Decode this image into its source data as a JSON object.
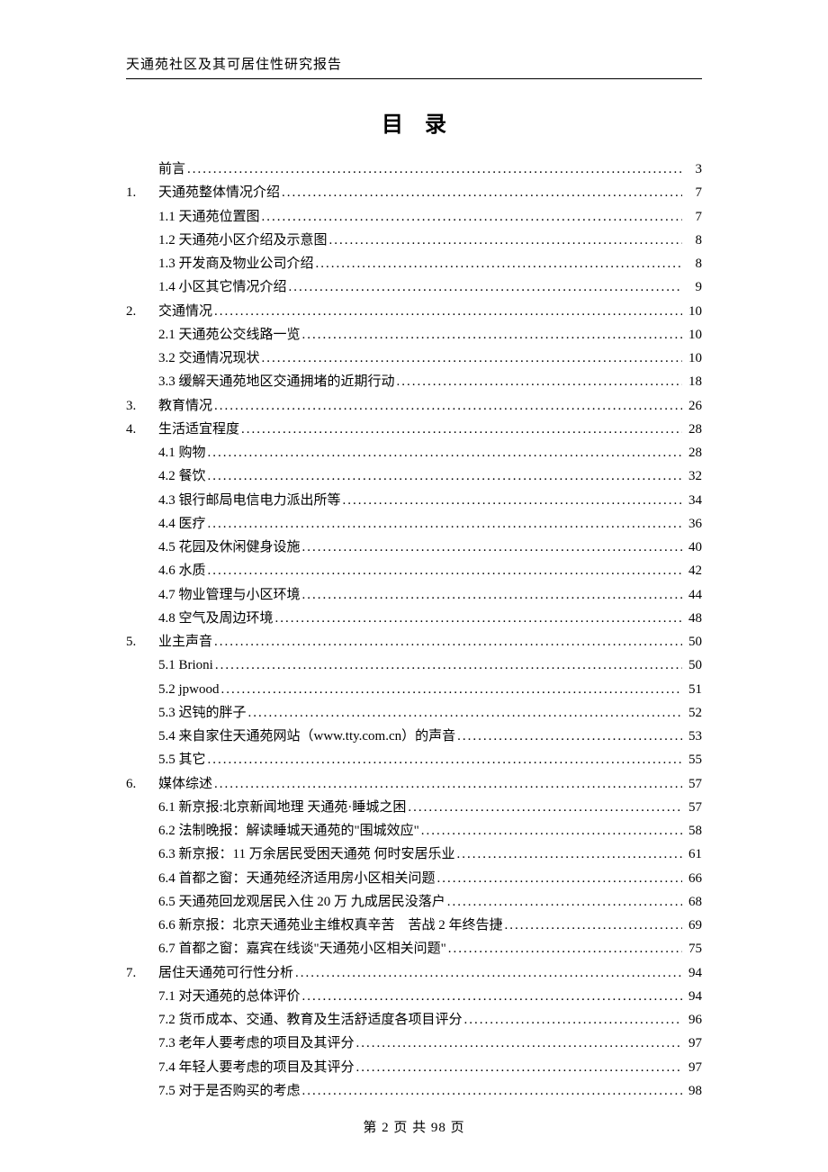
{
  "header_title": "天通苑社区及其可居住性研究报告",
  "toc_heading": "目录",
  "footer": "第 2 页 共 98 页",
  "toc": [
    {
      "level": 0,
      "num": "",
      "label": "前言",
      "page": "3"
    },
    {
      "level": 0,
      "num": "1.",
      "label": "天通苑整体情况介绍",
      "page": "7"
    },
    {
      "level": 1,
      "num": "",
      "label": "1.1 天通苑位置图",
      "page": "7"
    },
    {
      "level": 1,
      "num": "",
      "label": "1.2 天通苑小区介绍及示意图",
      "page": "8"
    },
    {
      "level": 1,
      "num": "",
      "label": "1.3 开发商及物业公司介绍",
      "page": "8"
    },
    {
      "level": 1,
      "num": "",
      "label": "1.4 小区其它情况介绍",
      "page": "9"
    },
    {
      "level": 0,
      "num": "2.",
      "label": "交通情况",
      "page": "10"
    },
    {
      "level": 1,
      "num": "",
      "label": "2.1 天通苑公交线路一览",
      "page": "10"
    },
    {
      "level": 1,
      "num": "",
      "label": "3.2 交通情况现状",
      "page": "10"
    },
    {
      "level": 1,
      "num": "",
      "label": "3.3 缓解天通苑地区交通拥堵的近期行动",
      "page": "18"
    },
    {
      "level": 0,
      "num": "3.",
      "label": "教育情况",
      "page": "26"
    },
    {
      "level": 0,
      "num": "4.",
      "label": "生活适宜程度",
      "page": "28"
    },
    {
      "level": 1,
      "num": "",
      "label": "4.1 购物",
      "page": "28"
    },
    {
      "level": 1,
      "num": "",
      "label": "4.2 餐饮",
      "page": "32"
    },
    {
      "level": 1,
      "num": "",
      "label": "4.3 银行邮局电信电力派出所等",
      "page": "34"
    },
    {
      "level": 1,
      "num": "",
      "label": "4.4 医疗",
      "page": "36"
    },
    {
      "level": 1,
      "num": "",
      "label": "4.5 花园及休闲健身设施",
      "page": "40"
    },
    {
      "level": 1,
      "num": "",
      "label": "4.6 水质",
      "page": "42"
    },
    {
      "level": 1,
      "num": "",
      "label": "4.7 物业管理与小区环境",
      "page": "44"
    },
    {
      "level": 1,
      "num": "",
      "label": "4.8 空气及周边环境",
      "page": "48"
    },
    {
      "level": 0,
      "num": "5.",
      "label": "业主声音",
      "page": "50"
    },
    {
      "level": 1,
      "num": "",
      "label": "5.1 Brioni ",
      "page": "50"
    },
    {
      "level": 1,
      "num": "",
      "label": "5.2 jpwood",
      "page": "51"
    },
    {
      "level": 1,
      "num": "",
      "label": "5.3 迟钝的胖子",
      "page": "52"
    },
    {
      "level": 1,
      "num": "",
      "label": "5.4 来自家住天通苑网站（www.tty.com.cn）的声音",
      "page": "53"
    },
    {
      "level": 1,
      "num": "",
      "label": "5.5 其它",
      "page": "55"
    },
    {
      "level": 0,
      "num": "6.",
      "label": "媒体综述",
      "page": "57"
    },
    {
      "level": 1,
      "num": "",
      "label": "6.1 新京报:北京新闻地理 天通苑·睡城之困",
      "page": "57"
    },
    {
      "level": 1,
      "num": "",
      "label": "6.2 法制晚报：解读睡城天通苑的\"围城效应\"",
      "page": "58"
    },
    {
      "level": 1,
      "num": "",
      "label": "6.3 新京报：11 万余居民受困天通苑 何时安居乐业",
      "page": "61"
    },
    {
      "level": 1,
      "num": "",
      "label": "6.4 首都之窗：天通苑经济适用房小区相关问题",
      "page": "66"
    },
    {
      "level": 1,
      "num": "",
      "label": "6.5 天通苑回龙观居民入住 20 万 九成居民没落户",
      "page": "68"
    },
    {
      "level": 1,
      "num": "",
      "label": "6.6 新京报：北京天通苑业主维权真辛苦　苦战 2 年终告捷",
      "page": "69"
    },
    {
      "level": 1,
      "num": "",
      "label": "6.7 首都之窗：嘉宾在线谈\"天通苑小区相关问题\"",
      "page": "75"
    },
    {
      "level": 0,
      "num": "7.",
      "label": "居住天通苑可行性分析",
      "page": "94"
    },
    {
      "level": 1,
      "num": "",
      "label": "7.1 对天通苑的总体评价",
      "page": "94"
    },
    {
      "level": 1,
      "num": "",
      "label": "7.2 货币成本、交通、教育及生活舒适度各项目评分",
      "page": "96"
    },
    {
      "level": 1,
      "num": "",
      "label": "7.3 老年人要考虑的项目及其评分",
      "page": "97"
    },
    {
      "level": 1,
      "num": "",
      "label": "7.4 年轻人要考虑的项目及其评分",
      "page": "97"
    },
    {
      "level": 1,
      "num": "",
      "label": "7.5 对于是否购买的考虑",
      "page": "98"
    }
  ]
}
